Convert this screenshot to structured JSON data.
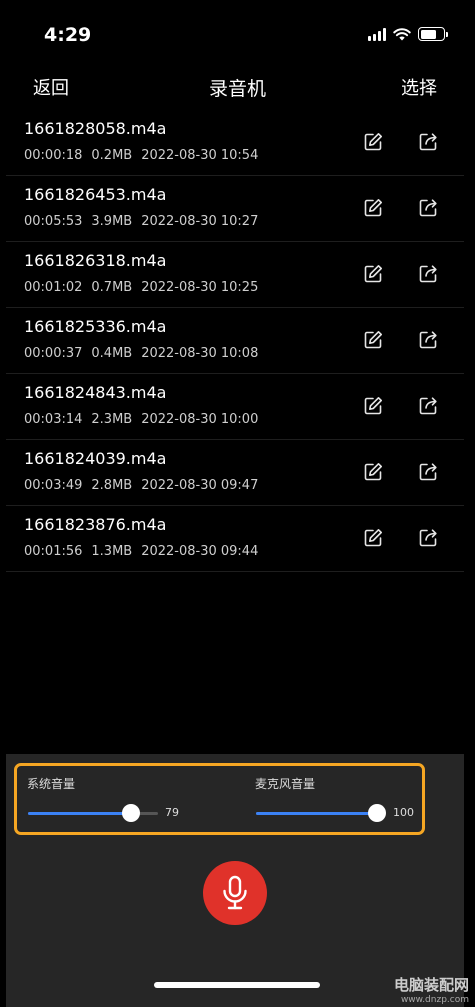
{
  "status_bar": {
    "time": "4:29"
  },
  "nav": {
    "back_label": "返回",
    "title": "录音机",
    "select_label": "选择"
  },
  "files": [
    {
      "name": "1661828058.m4a",
      "duration": "00:00:18",
      "size": "0.2MB",
      "date": "2022-08-30 10:54"
    },
    {
      "name": "1661826453.m4a",
      "duration": "00:05:53",
      "size": "3.9MB",
      "date": "2022-08-30 10:27"
    },
    {
      "name": "1661826318.m4a",
      "duration": "00:01:02",
      "size": "0.7MB",
      "date": "2022-08-30 10:25"
    },
    {
      "name": "1661825336.m4a",
      "duration": "00:00:37",
      "size": "0.4MB",
      "date": "2022-08-30 10:08"
    },
    {
      "name": "1661824843.m4a",
      "duration": "00:03:14",
      "size": "2.3MB",
      "date": "2022-08-30 10:00"
    },
    {
      "name": "1661824039.m4a",
      "duration": "00:03:49",
      "size": "2.8MB",
      "date": "2022-08-30 09:47"
    },
    {
      "name": "1661823876.m4a",
      "duration": "00:01:56",
      "size": "1.3MB",
      "date": "2022-08-30 09:44"
    }
  ],
  "file_icons": {
    "edit": "edit-icon",
    "share": "share-icon"
  },
  "volume": {
    "system": {
      "label": "系统音量",
      "value": 79,
      "value_text": "79"
    },
    "mic": {
      "label": "麦克风音量",
      "value": 100,
      "value_text": "100"
    }
  },
  "record": {
    "icon": "microphone-icon"
  },
  "colors": {
    "accent": "#3b82f6",
    "record": "#e0322a",
    "highlight": "#f5a623",
    "panel": "#262626"
  },
  "watermark": {
    "main": "电脑装配网",
    "url": "www.dnzp.com"
  }
}
